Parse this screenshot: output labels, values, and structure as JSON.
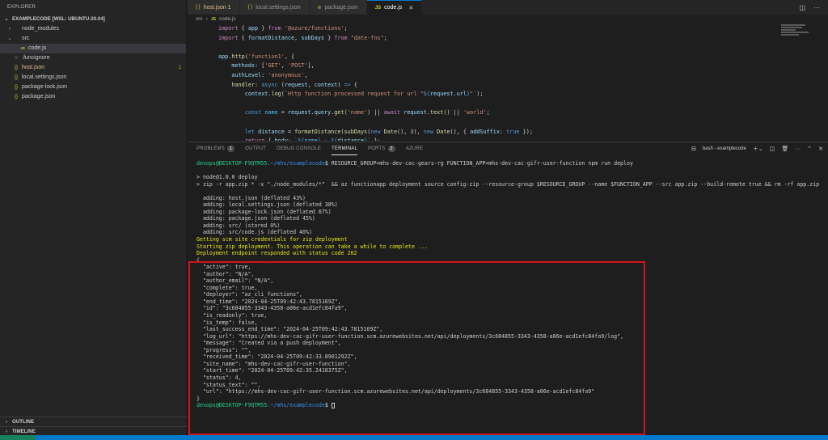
{
  "explorer": {
    "title": "EXPLORER",
    "root": "EXAMPLECODE [WSL: UBUNTU-20.04]",
    "items": [
      {
        "label": "node_modules",
        "type": "folder",
        "indent": 1,
        "expanded": false
      },
      {
        "label": "src",
        "type": "folder",
        "indent": 1,
        "expanded": true
      },
      {
        "label": "code.js",
        "type": "js",
        "indent": 2,
        "selected": true
      },
      {
        "label": ".funcignore",
        "type": "file",
        "indent": 1
      },
      {
        "label": "host.json",
        "type": "json",
        "indent": 1,
        "modified": true,
        "badge": "1"
      },
      {
        "label": "local.settings.json",
        "type": "json",
        "indent": 1
      },
      {
        "label": "package-lock.json",
        "type": "json",
        "indent": 1
      },
      {
        "label": "package.json",
        "type": "json",
        "indent": 1
      }
    ],
    "outline": "OUTLINE",
    "timeline": "TIMELINE"
  },
  "tabs": [
    {
      "label": "host.json 1",
      "icon": "{}",
      "modified": true
    },
    {
      "label": "local.settings.json",
      "icon": "{}"
    },
    {
      "label": "package.json",
      "icon": "npm"
    },
    {
      "label": "code.js",
      "icon": "JS",
      "active": true
    }
  ],
  "breadcrumb": [
    "src",
    "code.js"
  ],
  "panel": {
    "tabs": [
      {
        "label": "PROBLEMS",
        "badge": "1"
      },
      {
        "label": "OUTPUT"
      },
      {
        "label": "DEBUG CONSOLE"
      },
      {
        "label": "TERMINAL",
        "active": true
      },
      {
        "label": "PORTS",
        "badge": "2"
      },
      {
        "label": "AZURE"
      }
    ],
    "terminal_name": "bash - examplecode"
  },
  "colors": {
    "accent": "#007acc",
    "highlight_box": "#d0161c",
    "prompt_green": "#23d18b",
    "prompt_blue": "#3b8eea",
    "warning_yellow": "#e5e510"
  },
  "terminal": {
    "prompt_user": "devops@DESKTOP-F9QTM55",
    "prompt_path": ":~/mhs/examplecode",
    "command": "RESOURCE_GROUP=mhs-dev-cac-gears-rg FUNCTION_APP=mhs-dev-cac-gifr-user-function npm run deploy",
    "line_node": "> node@1.0.0 deploy",
    "line_zip": "> zip -r app.zip * -x \"./node_modules/*\"  && az functionapp deployment source config-zip --resource-group $RESOURCE_GROUP --name $FUNCTION_APP --src app.zip --build-remote true && rm -rf app.zip",
    "adding": [
      "  adding: host.json (deflated 43%)",
      "  adding: local.settings.json (deflated 38%)",
      "  adding: package-lock.json (deflated 67%)",
      "  adding: package.json (deflated 45%)",
      "  adding: src/ (stored 0%)",
      "  adding: src/code.js (deflated 40%)"
    ],
    "warn1": "Getting scm site credentials for zip deployment",
    "warn2": "Starting zip deployment. This operation can take a while to complete ...",
    "warn3": "Deployment endpoint responded with status code 202",
    "json_lines": [
      "{",
      "  \"active\": true,",
      "  \"author\": \"N/A\",",
      "  \"author_email\": \"N/A\",",
      "  \"complete\": true,",
      "  \"deployer\": \"az_cli_functions\",",
      "  \"end_time\": \"2024-04-25T09:42:43.7815169Z\",",
      "  \"id\": \"3c684855-3343-4358-a06e-acd1efc84fa9\",",
      "  \"is_readonly\": true,",
      "  \"is_temp\": false,",
      "  \"last_success_end_time\": \"2024-04-25T09:42:43.7815169Z\",",
      "  \"log_url\": \"https://mhs-dev-cac-gifr-user-function.scm.azurewebsites.net/api/deployments/3c684855-3343-4358-a06e-acd1efc84fa9/log\",",
      "  \"message\": \"Created via a push deployment\",",
      "  \"progress\": \"\",",
      "  \"received_time\": \"2024-04-25T09:42:33.8901292Z\",",
      "  \"site_name\": \"mhs-dev-cac-gifr-user-function\",",
      "  \"start_time\": \"2024-04-25T09:42:35.2418375Z\",",
      "  \"status\": 4,",
      "  \"status_text\": \"\",",
      "  \"url\": \"https://mhs-dev-cac-gifr-user-function.scm.azurewebsites.net/api/deployments/3c684855-3343-4358-a06e-acd1efc84fa9\"",
      "}"
    ]
  }
}
